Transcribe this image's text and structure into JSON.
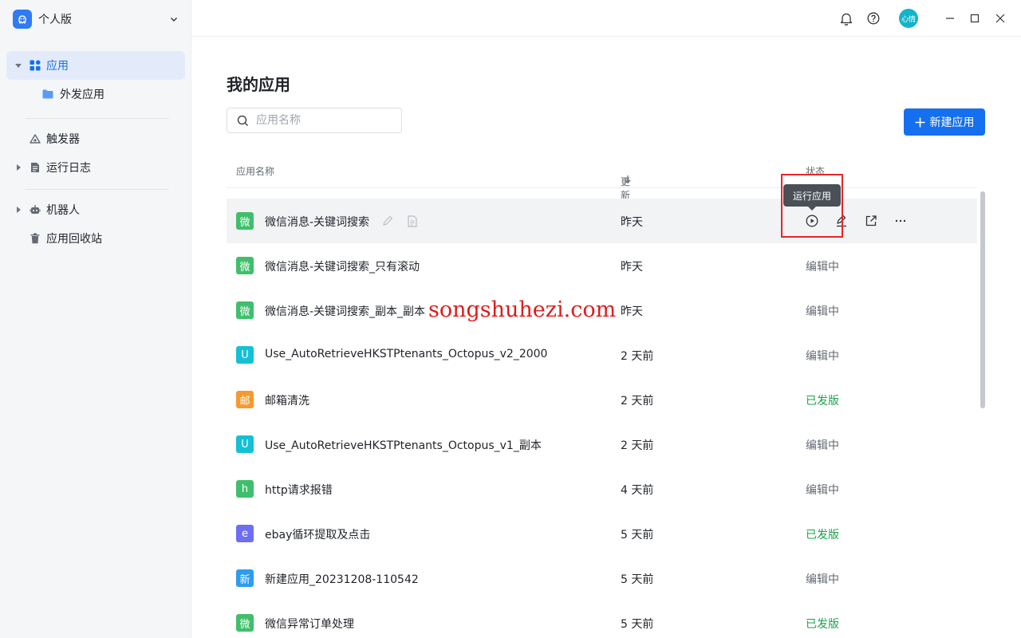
{
  "workspace": {
    "name": "个人版"
  },
  "sidebar": {
    "items": [
      {
        "label": "应用"
      },
      {
        "label": "外发应用"
      },
      {
        "label": "触发器"
      },
      {
        "label": "运行日志"
      },
      {
        "label": "机器人"
      },
      {
        "label": "应用回收站"
      }
    ]
  },
  "topbar": {
    "avatar_text": "心情"
  },
  "main": {
    "title": "我的应用",
    "search_placeholder": "应用名称",
    "new_button": "新建应用",
    "columns": {
      "name": "应用名称",
      "time": "更新时间",
      "status": "状态"
    },
    "tooltip": "运行应用",
    "watermark": "songshuhezi.com",
    "rows": [
      {
        "badge": "微",
        "badge_color": "#3fbf6b",
        "name": "微信消息-关键词搜索",
        "time": "昨天",
        "status": ""
      },
      {
        "badge": "微",
        "badge_color": "#3fbf6b",
        "name": "微信消息-关键词搜索_只有滚动",
        "time": "昨天",
        "status": "编辑中"
      },
      {
        "badge": "微",
        "badge_color": "#3fbf6b",
        "name": "微信消息-关键词搜索_副本_副本",
        "time": "昨天",
        "status": "编辑中"
      },
      {
        "badge": "U",
        "badge_color": "#14c0d4",
        "name": "Use_AutoRetrieveHKSTPtenants_Octopus_v2_2000",
        "time": "2 天前",
        "status": "编辑中"
      },
      {
        "badge": "邮",
        "badge_color": "#f59a2f",
        "name": "邮箱清洗",
        "time": "2 天前",
        "status": "已发版"
      },
      {
        "badge": "U",
        "badge_color": "#14c0d4",
        "name": "Use_AutoRetrieveHKSTPtenants_Octopus_v1_副本",
        "time": "2 天前",
        "status": "编辑中"
      },
      {
        "badge": "h",
        "badge_color": "#3fbf6b",
        "name": "http请求报错",
        "time": "4 天前",
        "status": "编辑中"
      },
      {
        "badge": "e",
        "badge_color": "#6b6ff0",
        "name": "ebay循环提取及点击",
        "time": "5 天前",
        "status": "已发版"
      },
      {
        "badge": "新",
        "badge_color": "#2d9cf0",
        "name": "新建应用_20231208-110542",
        "time": "5 天前",
        "status": "编辑中"
      },
      {
        "badge": "微",
        "badge_color": "#3fbf6b",
        "name": "微信异常订单处理",
        "time": "5 天前",
        "status": "已发版"
      }
    ]
  }
}
